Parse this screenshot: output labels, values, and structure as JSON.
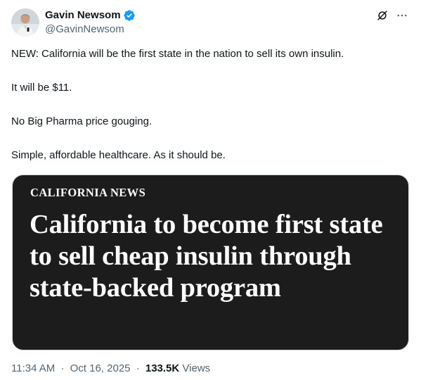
{
  "author": {
    "display_name": "Gavin Newsom",
    "handle": "@GavinNewsom",
    "verified": true,
    "verified_color": "#1d9bf0"
  },
  "header_icons": [
    "grok-icon",
    "more-icon"
  ],
  "tweet": {
    "paragraphs": [
      "NEW: California will be the first state in the nation to sell its own insulin.",
      "It will be $11.",
      "No Big Pharma price gouging.",
      "Simple, affordable healthcare. As it should be."
    ]
  },
  "card": {
    "kicker": "CALIFORNIA NEWS",
    "headline": "California to become first state to sell cheap insulin through state-backed program",
    "background": "#1c1c1c"
  },
  "meta": {
    "time": "11:34 AM",
    "date": "Oct 16, 2025",
    "separator": "·",
    "views_count": "133.5K",
    "views_label": "Views"
  }
}
